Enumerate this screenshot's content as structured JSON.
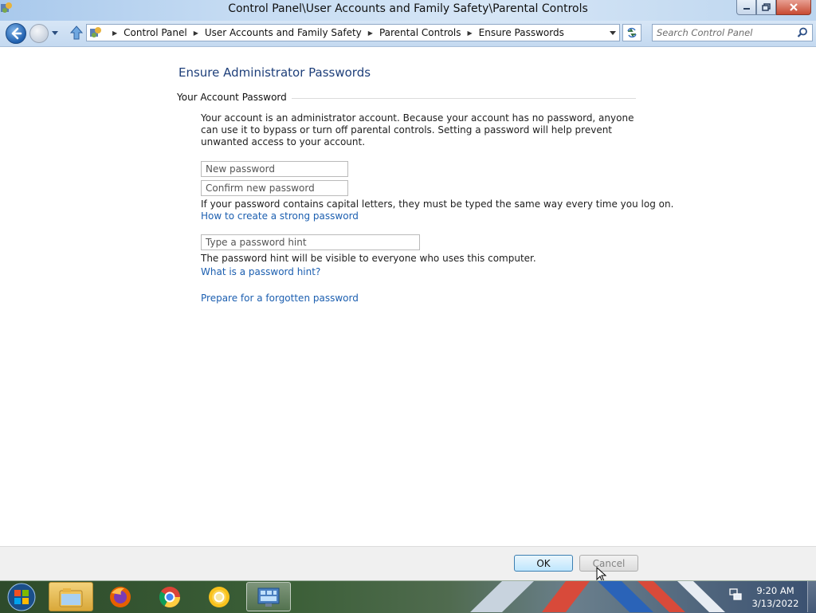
{
  "window": {
    "title": "Control Panel\\User Accounts and Family Safety\\Parental Controls"
  },
  "navigation": {
    "breadcrumbs": [
      "Control Panel",
      "User Accounts and Family Safety",
      "Parental Controls",
      "Ensure Passwords"
    ],
    "search_placeholder": "Search Control Panel"
  },
  "page": {
    "heading": "Ensure Administrator Passwords",
    "section_label": "Your Account Password",
    "description": "Your account is an administrator account. Because your account has no password, anyone can use it to bypass or turn off parental controls. Setting a password will help prevent unwanted access to your account.",
    "new_password_placeholder": "New password",
    "confirm_password_placeholder": "Confirm new password",
    "case_note": "If your password contains capital letters, they must be typed the same way every time you log on.",
    "strong_password_link": "How to create a strong password",
    "hint_placeholder": "Type a password hint",
    "hint_note": "The password hint will be visible to everyone who uses this computer.",
    "hint_link": "What is a password hint?",
    "forgotten_link": "Prepare for a forgotten password"
  },
  "footer": {
    "ok_label": "OK",
    "cancel_label": "Cancel"
  },
  "taskbar": {
    "time": "9:20 AM",
    "date": "3/13/2022",
    "pinned": [
      "windows-explorer",
      "firefox",
      "chrome",
      "chrome-canary",
      "control-panel"
    ]
  },
  "colors": {
    "heading": "#1e3f7a",
    "link": "#1c5fb0",
    "ok_border": "#3c7fb1"
  }
}
